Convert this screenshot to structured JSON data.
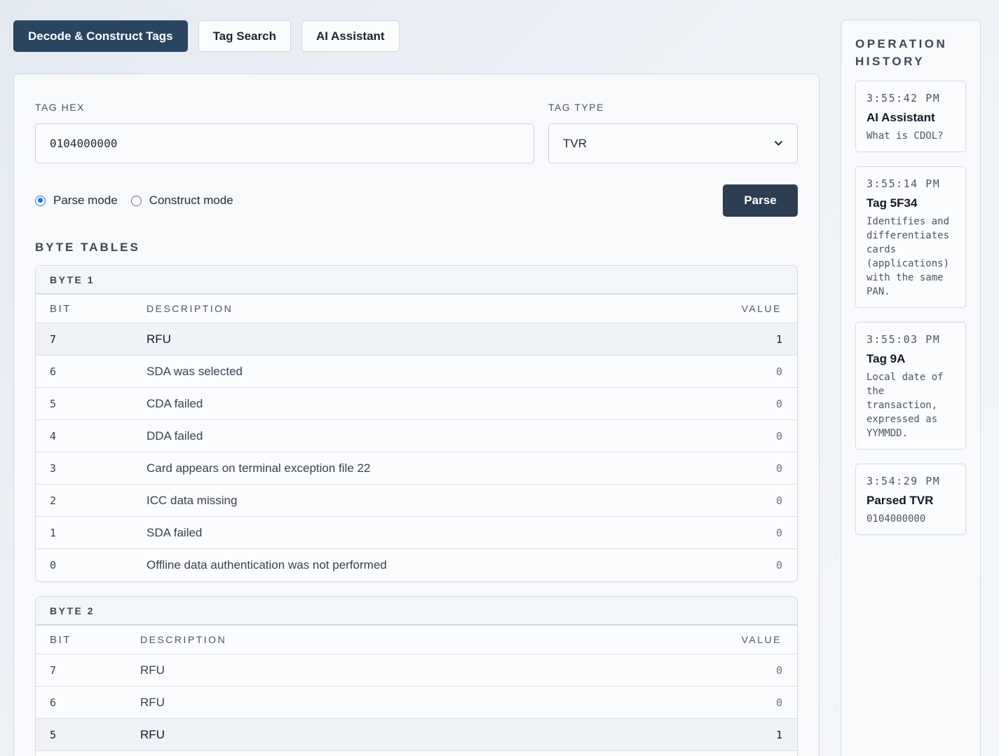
{
  "tabs": [
    {
      "label": "Decode & Construct Tags",
      "active": true
    },
    {
      "label": "Tag Search",
      "active": false
    },
    {
      "label": "AI Assistant",
      "active": false
    }
  ],
  "form": {
    "tag_hex_label": "TAG HEX",
    "tag_hex_value": "0104000000",
    "tag_type_label": "TAG TYPE",
    "tag_type_value": "TVR",
    "mode_parse": "Parse mode",
    "mode_construct": "Construct mode",
    "selected_mode": "parse",
    "parse_button": "Parse"
  },
  "byte_tables_title": "BYTE TABLES",
  "columns": {
    "bit": "BIT",
    "description": "DESCRIPTION",
    "value": "VALUE"
  },
  "byte1": {
    "title": "BYTE 1",
    "rows": [
      {
        "bit": "7",
        "desc": "RFU",
        "value": "1"
      },
      {
        "bit": "6",
        "desc": "SDA was selected",
        "value": "0"
      },
      {
        "bit": "5",
        "desc": "CDA failed",
        "value": "0"
      },
      {
        "bit": "4",
        "desc": "DDA failed",
        "value": "0"
      },
      {
        "bit": "3",
        "desc": "Card appears on terminal exception file 22",
        "value": "0"
      },
      {
        "bit": "2",
        "desc": "ICC data missing",
        "value": "0"
      },
      {
        "bit": "1",
        "desc": "SDA failed",
        "value": "0"
      },
      {
        "bit": "0",
        "desc": "Offline data authentication was not performed",
        "value": "0"
      }
    ]
  },
  "byte2": {
    "title": "BYTE 2",
    "rows": [
      {
        "bit": "7",
        "desc": "RFU",
        "value": "0"
      },
      {
        "bit": "6",
        "desc": "RFU",
        "value": "0"
      },
      {
        "bit": "5",
        "desc": "RFU",
        "value": "1"
      },
      {
        "bit": "4",
        "desc": "",
        "value": ""
      }
    ]
  },
  "history": {
    "title": "OPERATION HISTORY",
    "items": [
      {
        "time": "3:55:42 PM",
        "name": "AI Assistant",
        "desc": "What is CDOL?"
      },
      {
        "time": "3:55:14 PM",
        "name": "Tag 5F34",
        "desc": "Identifies and differentiates cards (applications) with the same PAN."
      },
      {
        "time": "3:55:03 PM",
        "name": "Tag 9A",
        "desc": "Local date of the transaction, expressed as YYMMDD."
      },
      {
        "time": "3:54:29 PM",
        "name": "Parsed TVR",
        "desc": "0104000000"
      }
    ]
  }
}
